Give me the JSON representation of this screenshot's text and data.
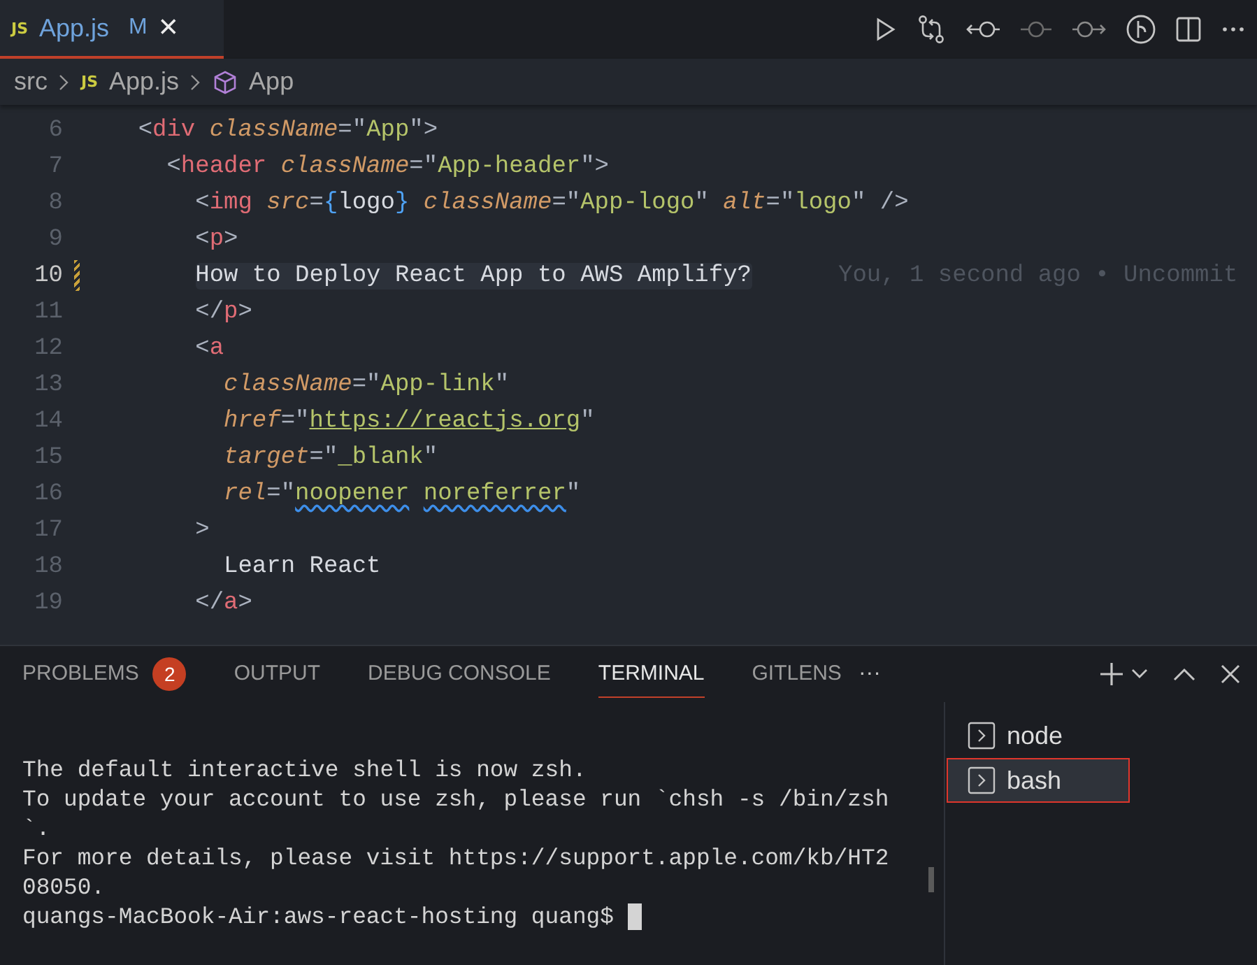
{
  "editor_tabs": [
    {
      "icon": "JS",
      "label": "App.js",
      "badge": "M",
      "selected": true,
      "close": "×"
    }
  ],
  "toolbar": [
    {
      "kind": "run"
    },
    {
      "kind": "compare"
    },
    {
      "kind": "prev"
    },
    {
      "kind": "dot"
    },
    {
      "kind": "next"
    },
    {
      "kind": "graph"
    },
    {
      "kind": "split"
    },
    {
      "kind": "more"
    }
  ],
  "breadcrumb": [
    {
      "kind": "folder",
      "label": "src"
    },
    {
      "kind": "file",
      "icon": "JS",
      "label": "App.js"
    },
    {
      "kind": "symbol",
      "label": "App"
    }
  ],
  "code": [
    {
      "num": "6",
      "modified": false,
      "highlight": false,
      "tokens": [
        {
          "kind": "punct",
          "text": "    <"
        },
        {
          "kind": "tag",
          "text": "div "
        },
        {
          "kind": "attr",
          "text": "className"
        },
        {
          "kind": "punct",
          "text": "=\""
        },
        {
          "kind": "str",
          "text": "App"
        },
        {
          "kind": "punct",
          "text": "\">"
        }
      ]
    },
    {
      "num": "7",
      "modified": false,
      "highlight": false,
      "tokens": [
        {
          "kind": "punct",
          "text": "      <"
        },
        {
          "kind": "tag",
          "text": "header "
        },
        {
          "kind": "attr",
          "text": "className"
        },
        {
          "kind": "punct",
          "text": "=\""
        },
        {
          "kind": "str",
          "text": "App-header"
        },
        {
          "kind": "punct",
          "text": "\">"
        }
      ]
    },
    {
      "num": "8",
      "modified": false,
      "highlight": false,
      "tokens": [
        {
          "kind": "punct",
          "text": "        <"
        },
        {
          "kind": "tag",
          "text": "img "
        },
        {
          "kind": "attr",
          "text": "src"
        },
        {
          "kind": "punct",
          "text": "="
        },
        {
          "kind": "brace",
          "text": "{"
        },
        {
          "kind": "text",
          "text": "logo"
        },
        {
          "kind": "brace",
          "text": "} "
        },
        {
          "kind": "attr",
          "text": "className"
        },
        {
          "kind": "punct",
          "text": "=\""
        },
        {
          "kind": "str",
          "text": "App-logo"
        },
        {
          "kind": "punct",
          "text": "\" "
        },
        {
          "kind": "attr",
          "text": "alt"
        },
        {
          "kind": "punct",
          "text": "=\""
        },
        {
          "kind": "str",
          "text": "logo"
        },
        {
          "kind": "punct",
          "text": "\" />"
        }
      ]
    },
    {
      "num": "9",
      "modified": false,
      "highlight": false,
      "tokens": [
        {
          "kind": "punct",
          "text": "        <"
        },
        {
          "kind": "tag",
          "text": "p"
        },
        {
          "kind": "punct",
          "text": ">"
        }
      ]
    },
    {
      "num": "10",
      "modified": true,
      "highlight": true,
      "blame": "You, 1 second ago • Uncommit",
      "tokens": [
        {
          "kind": "text",
          "text": "        How to Deploy React App to AWS Amplify?"
        }
      ]
    },
    {
      "num": "11",
      "modified": false,
      "highlight": false,
      "tokens": [
        {
          "kind": "punct",
          "text": "        </"
        },
        {
          "kind": "tag",
          "text": "p"
        },
        {
          "kind": "punct",
          "text": ">"
        }
      ]
    },
    {
      "num": "12",
      "modified": false,
      "highlight": false,
      "tokens": [
        {
          "kind": "punct",
          "text": "        <"
        },
        {
          "kind": "tag",
          "text": "a"
        }
      ]
    },
    {
      "num": "13",
      "modified": false,
      "highlight": false,
      "tokens": [
        {
          "kind": "attr",
          "text": "          className"
        },
        {
          "kind": "punct",
          "text": "=\""
        },
        {
          "kind": "str",
          "text": "App-link"
        },
        {
          "kind": "punct",
          "text": "\""
        }
      ]
    },
    {
      "num": "14",
      "modified": false,
      "highlight": false,
      "tokens": [
        {
          "kind": "attr",
          "text": "          href"
        },
        {
          "kind": "punct",
          "text": "=\""
        },
        {
          "kind": "link",
          "text": "https://reactjs.org"
        },
        {
          "kind": "punct",
          "text": "\""
        }
      ]
    },
    {
      "num": "15",
      "modified": false,
      "highlight": false,
      "tokens": [
        {
          "kind": "attr",
          "text": "          target"
        },
        {
          "kind": "punct",
          "text": "=\""
        },
        {
          "kind": "str",
          "text": "_blank"
        },
        {
          "kind": "punct",
          "text": "\""
        }
      ]
    },
    {
      "num": "16",
      "modified": false,
      "highlight": false,
      "tokens": [
        {
          "kind": "attr",
          "text": "          rel"
        },
        {
          "kind": "punct",
          "text": "=\""
        },
        {
          "kind": "warn",
          "text": "noopener"
        },
        {
          "kind": "warn",
          "text": " noreferrer"
        },
        {
          "kind": "punct",
          "text": "\""
        }
      ]
    },
    {
      "num": "17",
      "modified": false,
      "highlight": false,
      "tokens": [
        {
          "kind": "punct",
          "text": "        >"
        }
      ]
    },
    {
      "num": "18",
      "modified": false,
      "highlight": false,
      "tokens": [
        {
          "kind": "text",
          "text": "          Learn React"
        }
      ]
    },
    {
      "num": "19",
      "modified": false,
      "highlight": false,
      "tokens": [
        {
          "kind": "punct",
          "text": "        </"
        },
        {
          "kind": "tag",
          "text": "a"
        },
        {
          "kind": "punct",
          "text": ">"
        }
      ]
    }
  ],
  "panel_tabs": [
    {
      "label": "PROBLEMS",
      "badge": "2",
      "selected": false
    },
    {
      "label": "OUTPUT",
      "selected": false
    },
    {
      "label": "DEBUG CONSOLE",
      "selected": false
    },
    {
      "label": "TERMINAL",
      "selected": true
    },
    {
      "label": "GITLENS",
      "selected": false
    }
  ],
  "panel_more": "···",
  "terminal_lines": [
    "The default interactive shell is now zsh.",
    "To update your account to use zsh, please run `chsh -s /bin/zsh",
    "`.",
    "For more details, please visit https://support.apple.com/kb/HT2",
    "08050."
  ],
  "prompt": "quangs-MacBook-Air:aws-react-hosting quang$",
  "terminals": [
    {
      "label": "node",
      "selected": false
    },
    {
      "label": "bash",
      "selected": true
    }
  ]
}
